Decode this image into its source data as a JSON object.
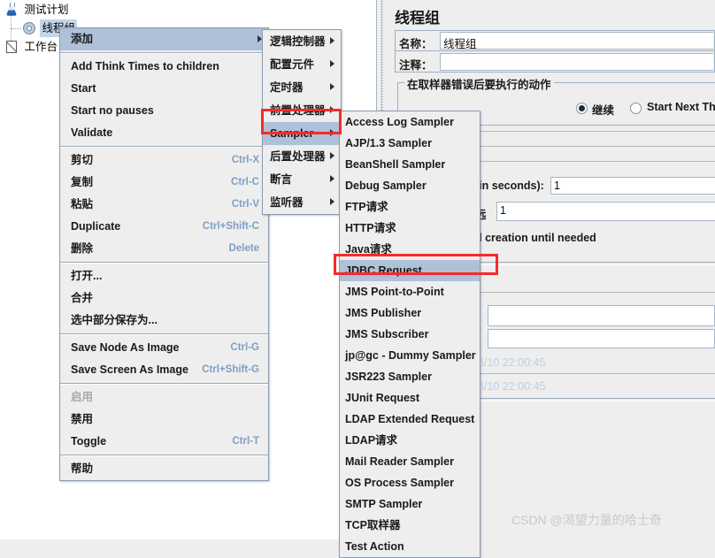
{
  "app": {
    "tree": {
      "nodes": [
        {
          "label": "测试计划",
          "icon": "test-plan-flask-icon",
          "selected": false
        },
        {
          "label": "线程组",
          "icon": "thread-group-gear-icon",
          "selected": true
        },
        {
          "label": "工作台",
          "icon": "workbench-icon",
          "selected": false
        }
      ]
    },
    "right_panel": {
      "title": "线程组",
      "name_label": "名称：",
      "name_value": "线程组",
      "comment_label": "注释：",
      "comment_value": "",
      "group_title": "在取样器错误后要执行的动作",
      "radio_continue": "继续",
      "radio_start_next": "Start Next Thre",
      "ramp_label": "(in seconds):",
      "ramp_value": "1",
      "loop_label": "远",
      "loop_value": "1",
      "delay_label": "d creation until needed",
      "field_a": "",
      "field_b": "",
      "timestamp_1": "06/10 22:00:45",
      "timestamp_2": "06/10 22:00:45"
    },
    "menu_add": {
      "items": [
        {
          "label": "添加",
          "accel": "",
          "submenu": true,
          "highlighted": true,
          "disabled": false
        },
        {
          "separator": true
        },
        {
          "label": "Add Think Times to children",
          "accel": "",
          "submenu": false,
          "highlighted": false,
          "disabled": false
        },
        {
          "label": "Start",
          "accel": "",
          "submenu": false,
          "highlighted": false,
          "disabled": false
        },
        {
          "label": "Start no pauses",
          "accel": "",
          "submenu": false,
          "highlighted": false,
          "disabled": false
        },
        {
          "label": "Validate",
          "accel": "",
          "submenu": false,
          "highlighted": false,
          "disabled": false
        },
        {
          "separator": true
        },
        {
          "label": "剪切",
          "accel": "Ctrl-X",
          "submenu": false,
          "highlighted": false,
          "disabled": false
        },
        {
          "label": "复制",
          "accel": "Ctrl-C",
          "submenu": false,
          "highlighted": false,
          "disabled": false
        },
        {
          "label": "粘贴",
          "accel": "Ctrl-V",
          "submenu": false,
          "highlighted": false,
          "disabled": false
        },
        {
          "label": "Duplicate",
          "accel": "Ctrl+Shift-C",
          "submenu": false,
          "highlighted": false,
          "disabled": false
        },
        {
          "label": "删除",
          "accel": "Delete",
          "submenu": false,
          "highlighted": false,
          "disabled": false
        },
        {
          "separator": true
        },
        {
          "label": "打开...",
          "accel": "",
          "submenu": false,
          "highlighted": false,
          "disabled": false
        },
        {
          "label": "合并",
          "accel": "",
          "submenu": false,
          "highlighted": false,
          "disabled": false
        },
        {
          "label": "选中部分保存为...",
          "accel": "",
          "submenu": false,
          "highlighted": false,
          "disabled": false
        },
        {
          "separator": true
        },
        {
          "label": "Save Node As Image",
          "accel": "Ctrl-G",
          "submenu": false,
          "highlighted": false,
          "disabled": false
        },
        {
          "label": "Save Screen As Image",
          "accel": "Ctrl+Shift-G",
          "submenu": false,
          "highlighted": false,
          "disabled": false
        },
        {
          "separator": true
        },
        {
          "label": "启用",
          "accel": "",
          "submenu": false,
          "highlighted": false,
          "disabled": true
        },
        {
          "label": "禁用",
          "accel": "",
          "submenu": false,
          "highlighted": false,
          "disabled": false
        },
        {
          "label": "Toggle",
          "accel": "Ctrl-T",
          "submenu": false,
          "highlighted": false,
          "disabled": false
        },
        {
          "separator": true
        },
        {
          "label": "帮助",
          "accel": "",
          "submenu": false,
          "highlighted": false,
          "disabled": false
        }
      ]
    },
    "menu_categories": {
      "items": [
        {
          "label": "逻辑控制器",
          "submenu": true,
          "highlighted": false
        },
        {
          "label": "配置元件",
          "submenu": true,
          "highlighted": false
        },
        {
          "label": "定时器",
          "submenu": true,
          "highlighted": false
        },
        {
          "label": "前置处理器",
          "submenu": true,
          "highlighted": false
        },
        {
          "label": "Sampler",
          "submenu": true,
          "highlighted": true
        },
        {
          "label": "后置处理器",
          "submenu": true,
          "highlighted": false
        },
        {
          "label": "断言",
          "submenu": true,
          "highlighted": false
        },
        {
          "label": "监听器",
          "submenu": true,
          "highlighted": false
        }
      ]
    },
    "menu_samplers": {
      "items": [
        {
          "label": "Access Log Sampler",
          "highlighted": false
        },
        {
          "label": "AJP/1.3 Sampler",
          "highlighted": false
        },
        {
          "label": "BeanShell Sampler",
          "highlighted": false
        },
        {
          "label": "Debug Sampler",
          "highlighted": false
        },
        {
          "label": "FTP请求",
          "highlighted": false
        },
        {
          "label": "HTTP请求",
          "highlighted": false
        },
        {
          "label": "Java请求",
          "highlighted": false
        },
        {
          "label": "JDBC Request",
          "highlighted": true
        },
        {
          "label": "JMS Point-to-Point",
          "highlighted": false
        },
        {
          "label": "JMS Publisher",
          "highlighted": false
        },
        {
          "label": "JMS Subscriber",
          "highlighted": false
        },
        {
          "label": "jp@gc - Dummy Sampler",
          "highlighted": false
        },
        {
          "label": "JSR223 Sampler",
          "highlighted": false
        },
        {
          "label": "JUnit Request",
          "highlighted": false
        },
        {
          "label": "LDAP Extended Request",
          "highlighted": false
        },
        {
          "label": "LDAP请求",
          "highlighted": false
        },
        {
          "label": "Mail Reader Sampler",
          "highlighted": false
        },
        {
          "label": "OS Process Sampler",
          "highlighted": false
        },
        {
          "label": "SMTP Sampler",
          "highlighted": false
        },
        {
          "label": "TCP取样器",
          "highlighted": false
        },
        {
          "label": "Test Action",
          "highlighted": false
        }
      ]
    },
    "annotations": {
      "highlight_color": "#f42b2b",
      "selection_color": "#aec1d8",
      "boxes": [
        "sampler-menu-item",
        "jdbc-request-menu-item"
      ]
    },
    "watermark": "CSDN @渴望力量的哈士奇"
  }
}
